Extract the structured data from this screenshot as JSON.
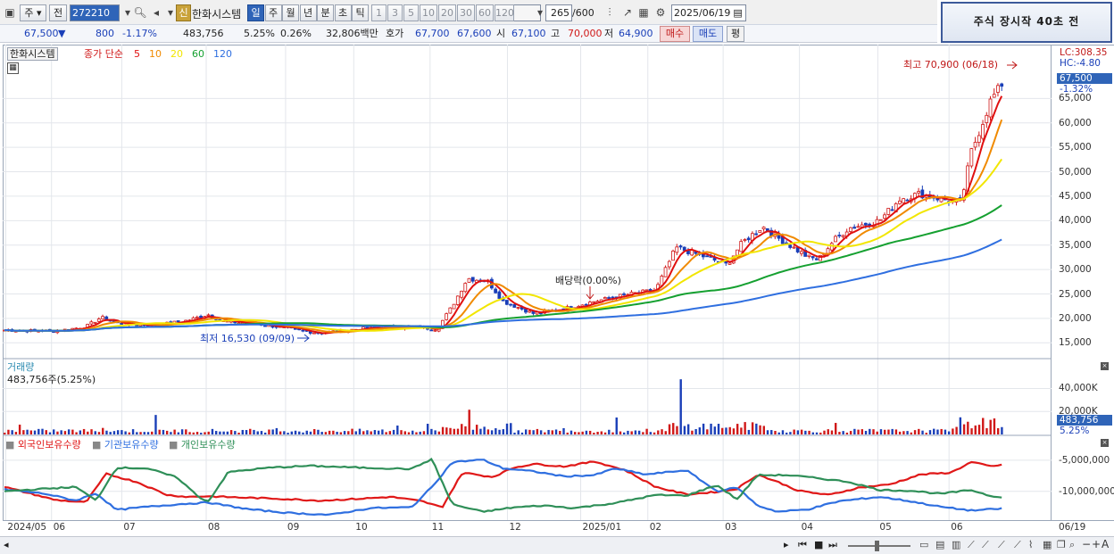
{
  "toolbar": {
    "market_type": "주",
    "prev_label": "전",
    "code": "272210",
    "stock_name": "한화시스템",
    "new_badge": "신",
    "periods": [
      "일",
      "주",
      "월",
      "년",
      "분",
      "초",
      "틱"
    ],
    "selected_period": "일",
    "intervals": [
      "1",
      "3",
      "5",
      "10",
      "20",
      "30",
      "60",
      "120"
    ],
    "count": "265",
    "count_total": "/600",
    "date": "2025/06/19"
  },
  "banner": "주식 장시작 40초 전",
  "quote": {
    "price": "67,500",
    "down_arrow": "▼",
    "change": "800",
    "change_pct": "-1.17%",
    "volume": "483,756",
    "vol_ratio": "5.25%",
    "turnover": "0.26%",
    "amount": "32,806백만",
    "bid_label": "호가",
    "ask_price": "67,700",
    "bid_price": "67,600",
    "open_label": "시",
    "open": "67,100",
    "high_label": "고",
    "high": "70,000",
    "low_label": "저",
    "low": "64,900",
    "buy_label": "매수",
    "sell_label": "매도",
    "eval_label": "평"
  },
  "legend": {
    "name": "한화시스템",
    "ma_title": "종가 단순",
    "ma": [
      {
        "label": "5",
        "color": "#e01010"
      },
      {
        "label": "10",
        "color": "#f08a00"
      },
      {
        "label": "20",
        "color": "#f2e600"
      },
      {
        "label": "60",
        "color": "#15a030"
      },
      {
        "label": "120",
        "color": "#2f6fe0"
      }
    ]
  },
  "annotations": {
    "high": "최고 70,900 (06/18)",
    "low": "최저 16,530 (09/09)",
    "dividend": "배당락(0.00%)"
  },
  "right_tags": {
    "lc": "LC:308.35",
    "hc": "HC:-4.80",
    "price": "67,500",
    "pct": "-1.32%",
    "vol": "483,756",
    "vol_pct": "5.25%"
  },
  "volume_panel": {
    "title": "거래량",
    "value": "483,756주(5.25%)"
  },
  "holdings_panel": {
    "series": [
      {
        "name": "외국인보유수량",
        "color": "#e01818"
      },
      {
        "name": "기관보유수량",
        "color": "#2f6fe0"
      },
      {
        "name": "개인보유수량",
        "color": "#2f8f58"
      }
    ]
  },
  "xaxis": [
    {
      "label": "2024/05",
      "pos": 0.003
    },
    {
      "label": "06",
      "pos": 0.048
    },
    {
      "label": "07",
      "pos": 0.117
    },
    {
      "label": "08",
      "pos": 0.2
    },
    {
      "label": "09",
      "pos": 0.278
    },
    {
      "label": "10",
      "pos": 0.345
    },
    {
      "label": "11",
      "pos": 0.42
    },
    {
      "label": "12",
      "pos": 0.496
    },
    {
      "label": "2025/01",
      "pos": 0.568
    },
    {
      "label": "02",
      "pos": 0.634
    },
    {
      "label": "03",
      "pos": 0.708
    },
    {
      "label": "04",
      "pos": 0.783
    },
    {
      "label": "05",
      "pos": 0.86
    },
    {
      "label": "06",
      "pos": 0.93
    },
    {
      "label": "06/19",
      "pos": 1.0
    }
  ],
  "chart_data": [
    {
      "type": "candlestick",
      "y_ticks": [
        "15,000",
        "20,000",
        "25,000",
        "30,000",
        "35,000",
        "40,000",
        "45,000",
        "50,000",
        "55,000",
        "60,000",
        "65,000"
      ],
      "ylim": [
        12500,
        72000
      ],
      "close_anchors": [
        [
          0,
          17600
        ],
        [
          0.05,
          17400
        ],
        [
          0.08,
          18300
        ],
        [
          0.095,
          20200
        ],
        [
          0.11,
          19000
        ],
        [
          0.15,
          18600
        ],
        [
          0.18,
          19600
        ],
        [
          0.2,
          20800
        ],
        [
          0.215,
          19400
        ],
        [
          0.25,
          18900
        ],
        [
          0.29,
          17500
        ],
        [
          0.31,
          17000
        ],
        [
          0.35,
          17900
        ],
        [
          0.4,
          18300
        ],
        [
          0.425,
          17800
        ],
        [
          0.44,
          22500
        ],
        [
          0.455,
          28200
        ],
        [
          0.475,
          27600
        ],
        [
          0.49,
          23500
        ],
        [
          0.52,
          21000
        ],
        [
          0.55,
          22000
        ],
        [
          0.58,
          23500
        ],
        [
          0.61,
          24800
        ],
        [
          0.64,
          25800
        ],
        [
          0.66,
          34500
        ],
        [
          0.69,
          32500
        ],
        [
          0.71,
          31000
        ],
        [
          0.725,
          35500
        ],
        [
          0.745,
          38800
        ],
        [
          0.76,
          36500
        ],
        [
          0.79,
          32500
        ],
        [
          0.8,
          32000
        ],
        [
          0.815,
          36000
        ],
        [
          0.83,
          38500
        ],
        [
          0.86,
          40000
        ],
        [
          0.88,
          44500
        ],
        [
          0.9,
          45500
        ],
        [
          0.92,
          44500
        ],
        [
          0.94,
          43500
        ],
        [
          0.95,
          54000
        ],
        [
          0.97,
          65000
        ],
        [
          0.98,
          67500
        ]
      ],
      "ma_periods": [
        5,
        10,
        20,
        60,
        120
      ]
    },
    {
      "type": "bar",
      "name": "거래량",
      "y_ticks": [
        "20,000K",
        "40,000K"
      ],
      "ylim": [
        0,
        52000
      ]
    },
    {
      "type": "line",
      "y_ticks": [
        "-5,000,000",
        "-10,000,000"
      ],
      "ylim": [
        -14500000,
        -3000000
      ],
      "series": [
        {
          "name": "외국인보유수량",
          "values": [
            [
              0,
              -9300000
            ],
            [
              0.05,
              -11400000
            ],
            [
              0.08,
              -11800000
            ],
            [
              0.1,
              -7200000
            ],
            [
              0.13,
              -8500000
            ],
            [
              0.16,
              -10600000
            ],
            [
              0.18,
              -10900000
            ],
            [
              0.2,
              -10800000
            ],
            [
              0.23,
              -11000000
            ],
            [
              0.27,
              -11200000
            ],
            [
              0.31,
              -11500000
            ],
            [
              0.35,
              -11200000
            ],
            [
              0.38,
              -10900000
            ],
            [
              0.41,
              -11600000
            ],
            [
              0.43,
              -12600000
            ],
            [
              0.45,
              -7000000
            ],
            [
              0.48,
              -7700000
            ],
            [
              0.5,
              -6200000
            ],
            [
              0.52,
              -5600000
            ],
            [
              0.55,
              -6000000
            ],
            [
              0.58,
              -5200000
            ],
            [
              0.61,
              -6600000
            ],
            [
              0.64,
              -9300000
            ],
            [
              0.67,
              -10500000
            ],
            [
              0.7,
              -10100000
            ],
            [
              0.72,
              -9600000
            ],
            [
              0.74,
              -7300000
            ],
            [
              0.76,
              -8500000
            ],
            [
              0.78,
              -9900000
            ],
            [
              0.81,
              -10600000
            ],
            [
              0.84,
              -9400000
            ],
            [
              0.87,
              -8900000
            ],
            [
              0.9,
              -7300000
            ],
            [
              0.93,
              -7000000
            ],
            [
              0.95,
              -5300000
            ],
            [
              0.97,
              -6000000
            ],
            [
              0.98,
              -5700000
            ]
          ]
        },
        {
          "name": "기관보유수량",
          "values": [
            [
              0,
              -9700000
            ],
            [
              0.04,
              -10400000
            ],
            [
              0.07,
              -11500000
            ],
            [
              0.09,
              -10300000
            ],
            [
              0.11,
              -13000000
            ],
            [
              0.14,
              -12500000
            ],
            [
              0.17,
              -12100000
            ],
            [
              0.2,
              -11800000
            ],
            [
              0.24,
              -12900000
            ],
            [
              0.28,
              -13500000
            ],
            [
              0.32,
              -13800000
            ],
            [
              0.36,
              -12700000
            ],
            [
              0.4,
              -12600000
            ],
            [
              0.42,
              -9300000
            ],
            [
              0.44,
              -5300000
            ],
            [
              0.47,
              -4900000
            ],
            [
              0.49,
              -6300000
            ],
            [
              0.52,
              -6800000
            ],
            [
              0.55,
              -7600000
            ],
            [
              0.58,
              -7400000
            ],
            [
              0.6,
              -6300000
            ],
            [
              0.63,
              -7300000
            ],
            [
              0.67,
              -6600000
            ],
            [
              0.7,
              -10000000
            ],
            [
              0.72,
              -9400000
            ],
            [
              0.74,
              -12300000
            ],
            [
              0.76,
              -13300000
            ],
            [
              0.79,
              -12900000
            ],
            [
              0.82,
              -11600000
            ],
            [
              0.86,
              -10900000
            ],
            [
              0.89,
              -11600000
            ],
            [
              0.92,
              -12500000
            ],
            [
              0.95,
              -13100000
            ],
            [
              0.97,
              -12900000
            ],
            [
              0.98,
              -12800000
            ]
          ]
        },
        {
          "name": "개인보유수량",
          "values": [
            [
              0,
              -10000000
            ],
            [
              0.04,
              -9600000
            ],
            [
              0.07,
              -9300000
            ],
            [
              0.09,
              -11500000
            ],
            [
              0.11,
              -6200000
            ],
            [
              0.14,
              -6300000
            ],
            [
              0.17,
              -7800000
            ],
            [
              0.19,
              -10800000
            ],
            [
              0.2,
              -11700000
            ],
            [
              0.22,
              -6900000
            ],
            [
              0.26,
              -6200000
            ],
            [
              0.3,
              -5900000
            ],
            [
              0.35,
              -6200000
            ],
            [
              0.4,
              -6400000
            ],
            [
              0.42,
              -4800000
            ],
            [
              0.44,
              -12100000
            ],
            [
              0.47,
              -13300000
            ],
            [
              0.5,
              -12600000
            ],
            [
              0.53,
              -12300000
            ],
            [
              0.56,
              -12700000
            ],
            [
              0.6,
              -11900000
            ],
            [
              0.64,
              -10600000
            ],
            [
              0.67,
              -10700000
            ],
            [
              0.7,
              -9000000
            ],
            [
              0.72,
              -11300000
            ],
            [
              0.74,
              -7400000
            ],
            [
              0.77,
              -7400000
            ],
            [
              0.8,
              -7900000
            ],
            [
              0.83,
              -8500000
            ],
            [
              0.86,
              -9800000
            ],
            [
              0.89,
              -9900000
            ],
            [
              0.92,
              -10400000
            ],
            [
              0.95,
              -9800000
            ],
            [
              0.97,
              -10800000
            ],
            [
              0.98,
              -10900000
            ]
          ]
        }
      ]
    }
  ]
}
